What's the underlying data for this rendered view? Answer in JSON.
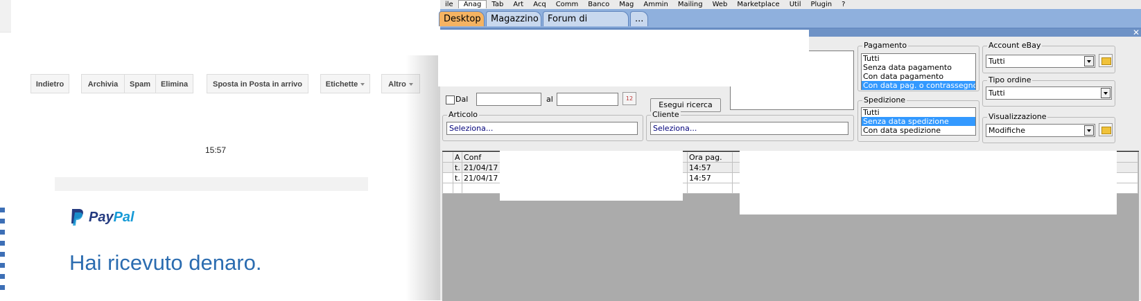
{
  "gmail": {
    "toolbar": {
      "back": "Indietro",
      "archive": "Archivia",
      "spam": "Spam",
      "delete": "Elimina",
      "move_inbox": "Sposta in Posta in arrivo",
      "labels": "Etichette",
      "more": "Altro"
    },
    "time": "15:57",
    "logo_text_1": "Pay",
    "logo_text_2": "Pal",
    "heading": "Hai ricevuto denaro."
  },
  "app": {
    "menu": [
      "ile",
      "Anag",
      "Tab",
      "Art",
      "Acq",
      "Comm",
      "Banco",
      "Mag",
      "Ammin",
      "Mailing",
      "Web",
      "Marketplace",
      "Util",
      "Plugin",
      "?"
    ],
    "tabs": [
      "Desktop",
      "Magazzino",
      "Forum di supporto",
      "..."
    ],
    "filters": {
      "dal_label": "Dal",
      "al_label": "al",
      "search_button": "Esegui ricerca",
      "articolo_label": "Articolo",
      "articolo_value": "Seleziona...",
      "cliente_label": "Cliente",
      "cliente_value": "Seleziona...",
      "pagamento_label": "Pagamento",
      "pagamento_options": [
        "Tutti",
        "Senza data pagamento",
        "Con data pagamento",
        "Con data pag. o contrassegno"
      ],
      "spedizione_label": "Spedizione",
      "spedizione_options": [
        "Tutti",
        "Senza data spedizione",
        "Con data spedizione"
      ],
      "account_label": "Account eBay",
      "account_value": "Tutti",
      "tipo_label": "Tipo ordine",
      "tipo_value": "Tutti",
      "vis_label": "Visualizzazione",
      "vis_value": "Modifiche"
    },
    "grid": {
      "headers": [
        "A",
        "Conf",
        "Ora pag."
      ],
      "rows": [
        [
          "t.",
          "21/04/17",
          "14:57"
        ],
        [
          "t.",
          "21/04/17",
          "14:57"
        ]
      ]
    }
  }
}
